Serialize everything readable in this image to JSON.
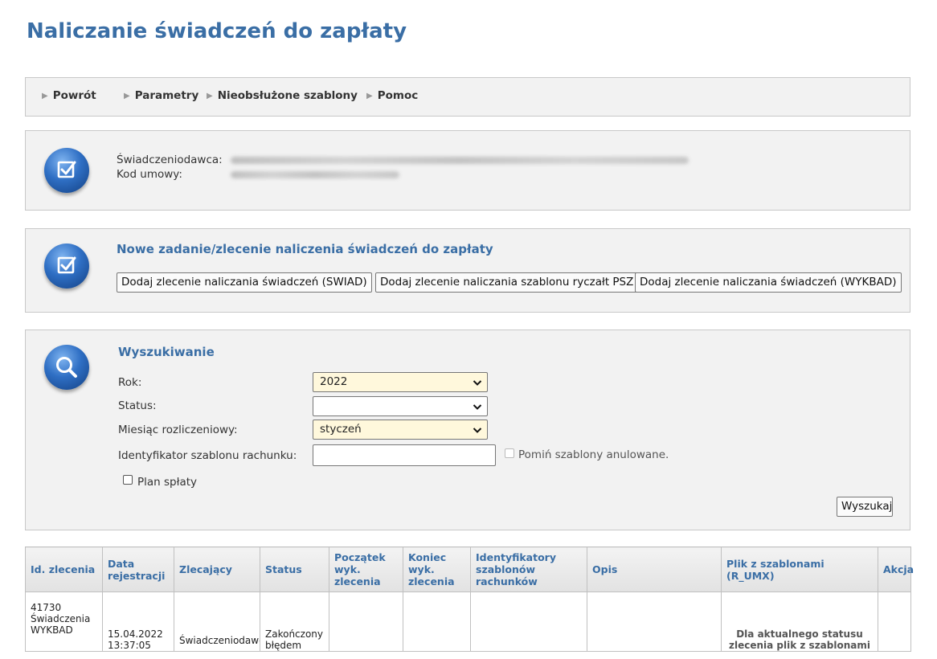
{
  "page_title": "Naliczanie świadczeń do zapłaty",
  "nav": {
    "back": "Powrót",
    "params": "Parametry",
    "unhandled": "Nieobsłużone szablony",
    "help": "Pomoc"
  },
  "provider": {
    "provider_label": "Świadczeniodawca:",
    "contract_label": "Kod umowy:"
  },
  "new_task": {
    "title": "Nowe zadanie/zlecenie naliczenia świadczeń do zapłaty",
    "btn_swiad": "Dodaj zlecenie naliczania świadczeń (SWIAD)",
    "btn_psz": "Dodaj zlecenie naliczania szablonu ryczałt PSZ",
    "btn_wykbad": "Dodaj zlecenie naliczania świadczeń (WYKBAD)"
  },
  "search": {
    "title": "Wyszukiwanie",
    "year_label": "Rok:",
    "year_value": "2022",
    "status_label": "Status:",
    "status_value": "",
    "month_label": "Miesiąc rozliczeniowy:",
    "month_value": "styczeń",
    "template_id_label": "Identyfikator szablonu rachunku:",
    "template_id_value": "",
    "skip_cancelled_label": "Pomiń szablony anulowane.",
    "plan_label": "Plan spłaty",
    "search_button": "Wyszukaj"
  },
  "table": {
    "headers": [
      "Id. zlecenia",
      "Data rejestracji",
      "Zlecający",
      "Status",
      "Początek wyk. zlecenia",
      "Koniec wyk. zlecenia",
      "Identyfikatory szablonów rachunków",
      "Opis",
      "Plik z szablonami (R_UMX)",
      "Akcja"
    ],
    "rows": [
      {
        "id": "41730",
        "id_type1": "Świadczenia",
        "id_type2": "WYKBAD",
        "date": "15.04.2022",
        "time": "13:37:05",
        "ordering": "Świadczeniodawca",
        "status1": "Zakończony",
        "status2": "błędem",
        "start": "",
        "end": "",
        "template_ids": "",
        "description": "",
        "file": "Dla aktualnego statusu zlecenia plik z szablonami nie jest dostępny",
        "action": ""
      }
    ]
  },
  "colors": {
    "accent": "#3a6ea5",
    "panel_bg": "#f2f2f2",
    "select_highlight": "#fff8dc"
  }
}
